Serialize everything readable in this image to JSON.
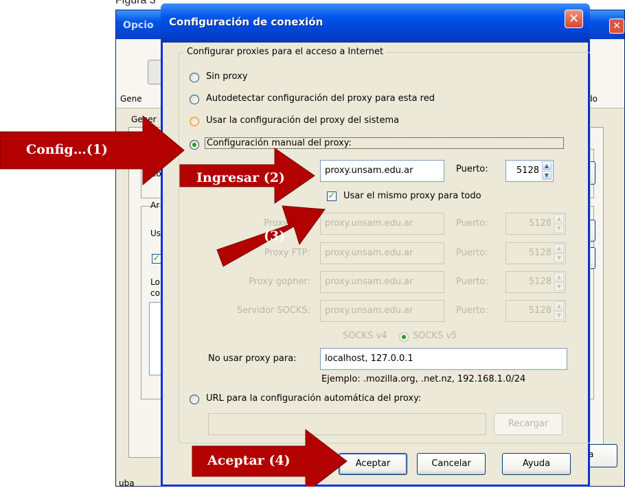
{
  "caption": "Figura 3",
  "background_window": {
    "title": "Opcio",
    "close_glyph": "✕",
    "toolbar_labels": [
      "Gene",
      "do"
    ],
    "tab": "Gener",
    "section_labels": [
      "Co",
      "Ar",
      "Us",
      "Lo",
      "co"
    ],
    "right_button": "a",
    "status": "uba"
  },
  "dialog": {
    "title": "Configuración de conexión",
    "close_glyph": "✕",
    "group_label": "Configurar proxies para el acceso a Internet",
    "options": {
      "no_proxy": "Sin proxy",
      "autodetect": "Autodetectar configuración del proxy para esta red",
      "system": "Usar la configuración del proxy del sistema",
      "manual": "Configuración manual del proxy:",
      "auto_url": "URL para la configuración automática del proxy:"
    },
    "http_proxy": {
      "value": "proxy.unsam.edu.ar",
      "port_label": "Puerto:",
      "port": "5128"
    },
    "same_proxy_label": "Usar el mismo proxy para todo",
    "ssl_proxy": {
      "label": "Proxy SSL:",
      "value": "proxy.unsam.edu.ar",
      "port_label": "Puerto:",
      "port": "5128"
    },
    "ftp_proxy": {
      "label": "Proxy FTP:",
      "value": "proxy.unsam.edu.ar",
      "port_label": "Puerto:",
      "port": "5128"
    },
    "gopher_proxy": {
      "label": "Proxy gopher:",
      "value": "proxy.unsam.edu.ar",
      "port_label": "Puerto:",
      "port": "5128"
    },
    "socks_host": {
      "label": "Servidor SOCKS:",
      "value": "proxy.unsam.edu.ar",
      "port_label": "Puerto:",
      "port": "5128"
    },
    "socks_v4": "SOCKS v4",
    "socks_v5": "SOCKS v5",
    "no_proxy_for": {
      "label": "No usar proxy para:",
      "value": "localhost, 127.0.0.1"
    },
    "example": "Ejemplo: .mozilla.org, .net.nz, 192.168.1.0/24",
    "auto_url_value": "",
    "reload_button": "Recargar",
    "ok_button": "Aceptar",
    "cancel_button": "Cancelar",
    "help_button": "Ayuda"
  },
  "annotations": {
    "step1": "Config…(1)",
    "step2": "Ingresar (2)",
    "step3": "(3)",
    "step4": "Aceptar (4)"
  },
  "colors": {
    "annotation_arrow": "#b30000",
    "title_bar": "#0055ea",
    "dialog_bg": "#ece9d8",
    "close_button": "#d9452c"
  }
}
